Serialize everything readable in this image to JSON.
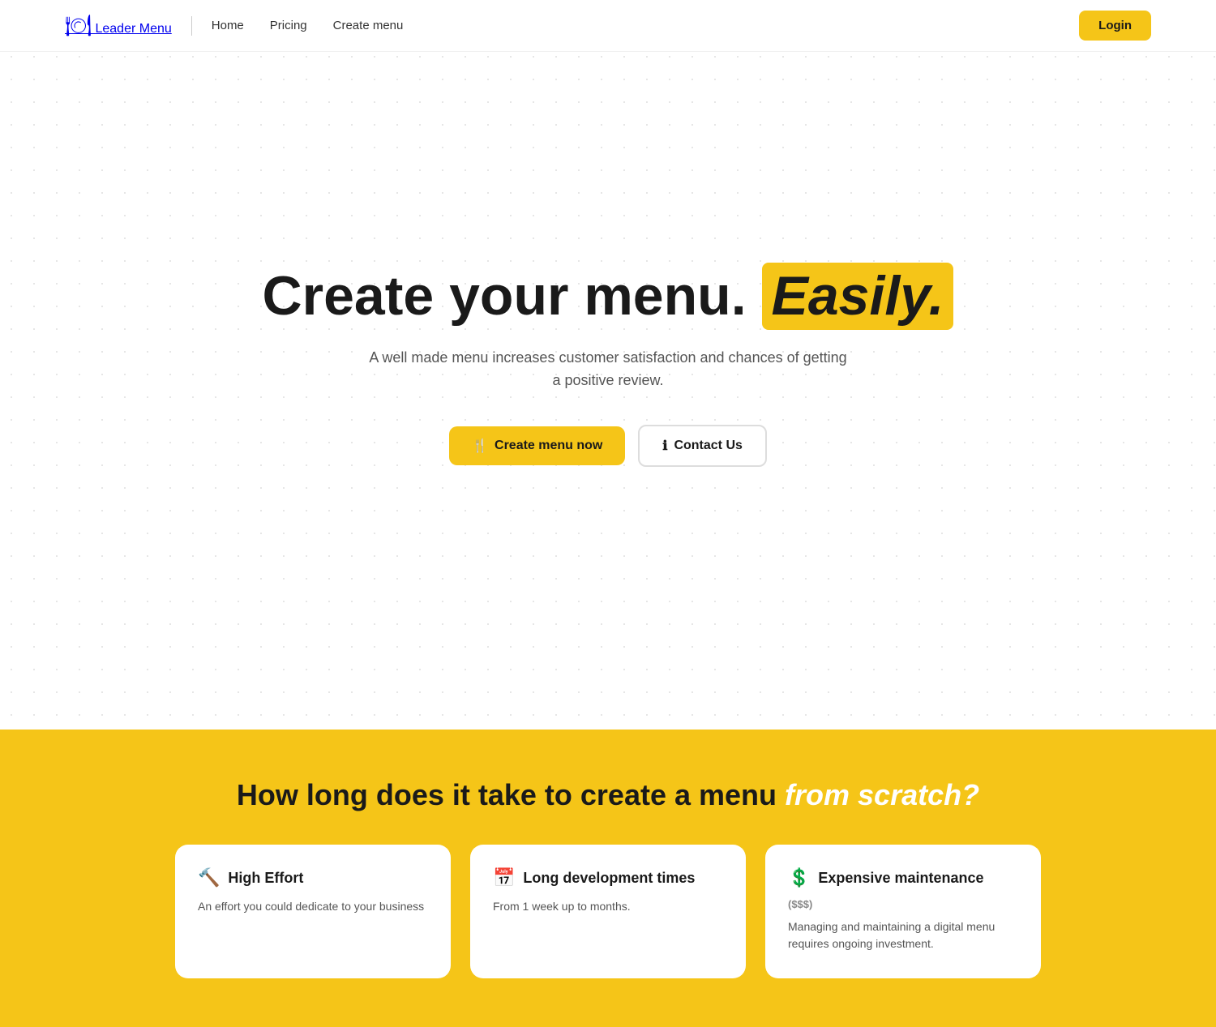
{
  "nav": {
    "logo_icon": "🍽",
    "logo_text": "Leader Menu",
    "links": [
      {
        "label": "Home",
        "id": "home"
      },
      {
        "label": "Pricing",
        "id": "pricing"
      },
      {
        "label": "Create menu",
        "id": "create-menu"
      }
    ],
    "login_label": "Login"
  },
  "hero": {
    "title_main": "Create your menu.",
    "title_highlight": "Easily.",
    "subtitle": "A well made menu increases customer satisfaction and chances of getting a positive review.",
    "btn_primary_icon": "🍴",
    "btn_primary_label": "Create menu now",
    "btn_secondary_icon": "ℹ",
    "btn_secondary_label": "Contact Us"
  },
  "yellow_section": {
    "title_main": "How long does it take to create a menu",
    "title_highlight": "from scratch?",
    "cards": [
      {
        "id": "high-effort",
        "icon": "🔨",
        "title": "High Effort",
        "subtitle": "",
        "description": "An effort you could dedicate to your business"
      },
      {
        "id": "long-development",
        "icon": "📅",
        "title": "Long development times",
        "subtitle": "",
        "description": "From 1 week up to months."
      },
      {
        "id": "expensive-maintenance",
        "icon": "💲",
        "title": "Expensive maintenance",
        "subtitle": "($$$)",
        "description": "Managing and maintaining a digital menu requires ongoing investment."
      }
    ]
  }
}
